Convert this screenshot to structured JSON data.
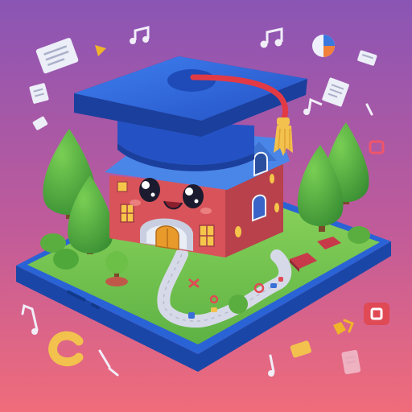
{
  "colors": {
    "bg_top": "#7d57b3",
    "bg_bottom": "#f0687a",
    "platform_blue": "#2a63d6",
    "platform_dark": "#1a46a8",
    "grass": "#72c552",
    "grass_light": "#9be06c",
    "house_red": "#d45055",
    "house_red_dark": "#ad3a46",
    "roof_blue": "#4a86e8",
    "cap_blue": "#2f66d8",
    "tassel_red": "#e23a45",
    "tassel_gold": "#f2c14e",
    "door_orange": "#e89a2a",
    "window_yellow": "#f5c64a",
    "tree_green": "#4fa83a",
    "path_grey": "#d8dce8"
  },
  "icons": [
    "graduation-cap-icon",
    "music-note-icon",
    "document-icon",
    "pie-chart-icon",
    "book-icon",
    "letter-c-icon",
    "tree-icon"
  ]
}
